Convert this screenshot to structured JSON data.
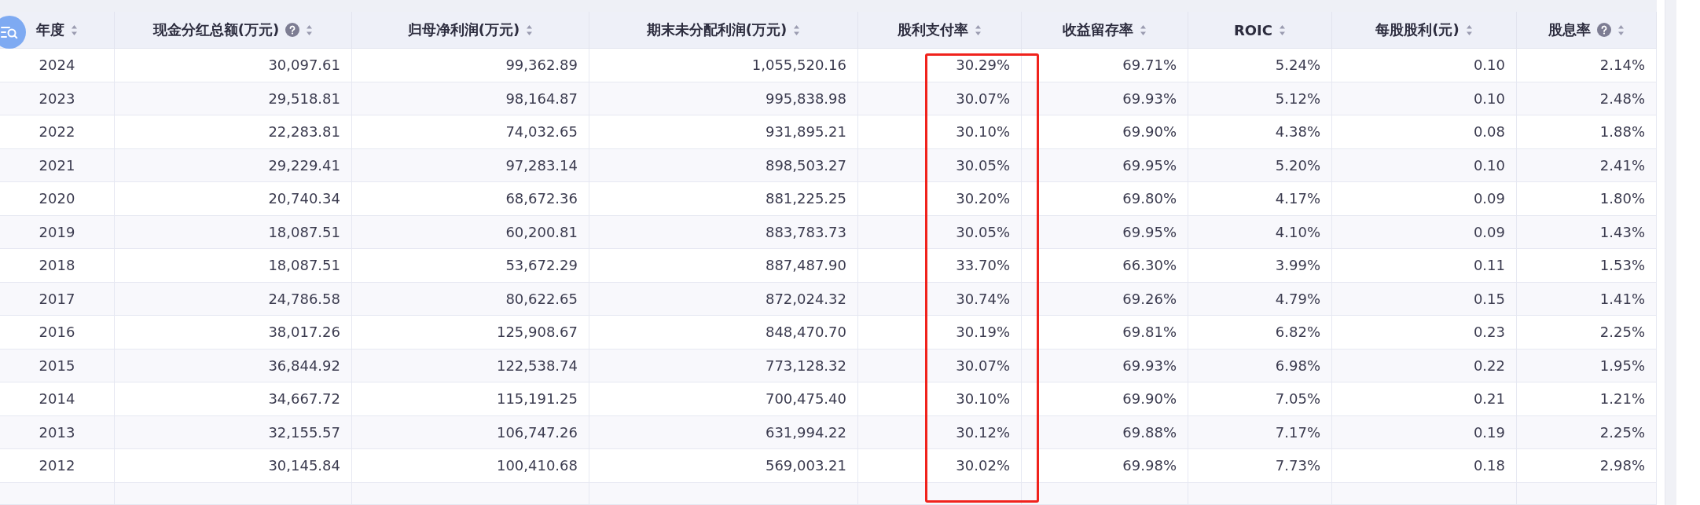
{
  "table": {
    "columns": [
      {
        "label": "年度",
        "help": false
      },
      {
        "label": "现金分红总额(万元)",
        "help": true
      },
      {
        "label": "归母净利润(万元)",
        "help": false
      },
      {
        "label": "期末未分配利润(万元)",
        "help": false
      },
      {
        "label": "股利支付率",
        "help": false,
        "highlighted": true
      },
      {
        "label": "收益留存率",
        "help": false
      },
      {
        "label": "ROIC",
        "help": false
      },
      {
        "label": "每股股利(元)",
        "help": false
      },
      {
        "label": "股息率",
        "help": true
      }
    ],
    "rows": [
      [
        "2024",
        "30,097.61",
        "99,362.89",
        "1,055,520.16",
        "30.29%",
        "69.71%",
        "5.24%",
        "0.10",
        "2.14%"
      ],
      [
        "2023",
        "29,518.81",
        "98,164.87",
        "995,838.98",
        "30.07%",
        "69.93%",
        "5.12%",
        "0.10",
        "2.48%"
      ],
      [
        "2022",
        "22,283.81",
        "74,032.65",
        "931,895.21",
        "30.10%",
        "69.90%",
        "4.38%",
        "0.08",
        "1.88%"
      ],
      [
        "2021",
        "29,229.41",
        "97,283.14",
        "898,503.27",
        "30.05%",
        "69.95%",
        "5.20%",
        "0.10",
        "2.41%"
      ],
      [
        "2020",
        "20,740.34",
        "68,672.36",
        "881,225.25",
        "30.20%",
        "69.80%",
        "4.17%",
        "0.09",
        "1.80%"
      ],
      [
        "2019",
        "18,087.51",
        "60,200.81",
        "883,783.73",
        "30.05%",
        "69.95%",
        "4.10%",
        "0.09",
        "1.43%"
      ],
      [
        "2018",
        "18,087.51",
        "53,672.29",
        "887,487.90",
        "33.70%",
        "66.30%",
        "3.99%",
        "0.11",
        "1.53%"
      ],
      [
        "2017",
        "24,786.58",
        "80,622.65",
        "872,024.32",
        "30.74%",
        "69.26%",
        "4.79%",
        "0.15",
        "1.41%"
      ],
      [
        "2016",
        "38,017.26",
        "125,908.67",
        "848,470.70",
        "30.19%",
        "69.81%",
        "6.82%",
        "0.23",
        "2.25%"
      ],
      [
        "2015",
        "36,844.92",
        "122,538.74",
        "773,128.32",
        "30.07%",
        "69.93%",
        "6.98%",
        "0.22",
        "1.95%"
      ],
      [
        "2014",
        "34,667.72",
        "115,191.25",
        "700,475.40",
        "30.10%",
        "69.90%",
        "7.05%",
        "0.21",
        "1.21%"
      ],
      [
        "2013",
        "32,155.57",
        "106,747.26",
        "631,994.22",
        "30.12%",
        "69.88%",
        "7.17%",
        "0.19",
        "2.25%"
      ],
      [
        "2012",
        "30,145.84",
        "100,410.68",
        "569,003.21",
        "30.02%",
        "69.98%",
        "7.73%",
        "0.18",
        "2.98%"
      ]
    ]
  }
}
